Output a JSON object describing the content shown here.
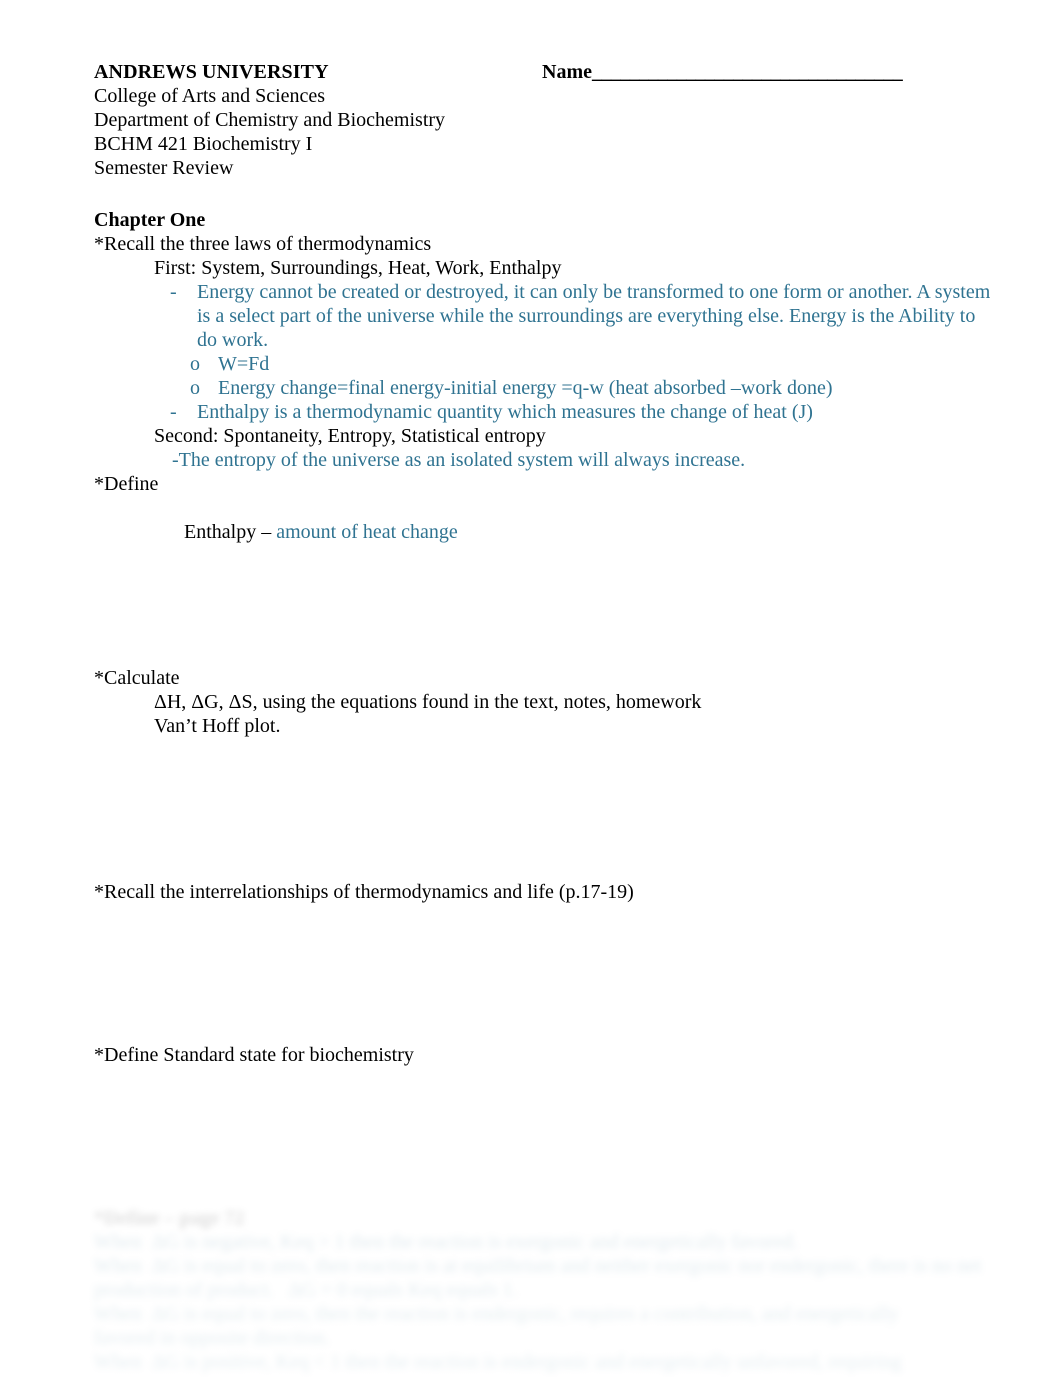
{
  "header": {
    "university": "ANDREWS UNIVERSITY",
    "name_label": "Name",
    "name_rule": "_________________________________",
    "lines": [
      "College of Arts and Sciences",
      "Department of Chemistry and Biochemistry",
      "BCHM 421 Biochemistry I",
      "Semester Review"
    ]
  },
  "chapter": {
    "heading": "Chapter One",
    "recall_laws": "*Recall the three laws of thermodynamics",
    "first_label": "First: System, Surroundings, Heat, Work, Enthalpy",
    "first_answer_dash": "-",
    "first_answer": "Energy cannot be created or destroyed, it can only be transformed to one form or another. A system is a select part of the universe while the surroundings are everything else. Energy is the Ability to do work.",
    "o_bullet": "o",
    "o_item_1": "W=Fd",
    "o_item_2": "Energy change=final energy-initial energy =q-w (heat absorbed –work done)",
    "enthalpy_dash": "-",
    "enthalpy_answer": "Enthalpy is a thermodynamic quantity  which measures the change of heat (J)",
    "second_label": "Second: Spontaneity, Entropy, Statistical entropy",
    "second_answer": "-The entropy of the universe as an isolated system will always increase."
  },
  "define": {
    "prompt": "*Define",
    "term": "Enthalpy – ",
    "answer": "amount of heat change"
  },
  "calculate": {
    "prompt": "*Calculate",
    "line_1": "ΔH, ΔG, ΔS, using the equations found in the text, notes, homework",
    "line_2": "Van’t Hoff plot."
  },
  "recall_interrelationships": "*Recall the interrelationships of thermodynamics and life (p.17-19)",
  "define_standard_state": "*Define Standard state for biochemistry",
  "faded_tail": {
    "heading": "*Define – page 72",
    "lines": [
      "When  ΔG is negative, Keq > 1 then the reaction is exergonic and energetically favored.",
      "When  ΔG is equal to zero, then reaction is at equilibrium and neither exergonic nor endergonic, there is no net",
      "production of product.   ΔG = 0 equals Keq equals 1.",
      "When  ΔG is equal to zero, then the reaction is endergonic, requires a contribution, and energetically",
      "favored in opposite direction.",
      "When  ΔG is positive, Keq < 1 then the reaction is endergonic and energetically unfavored, requiring"
    ]
  },
  "colors": {
    "answer_teal": "#2f7391",
    "body_text": "#000000",
    "page_background": "#ffffff"
  }
}
